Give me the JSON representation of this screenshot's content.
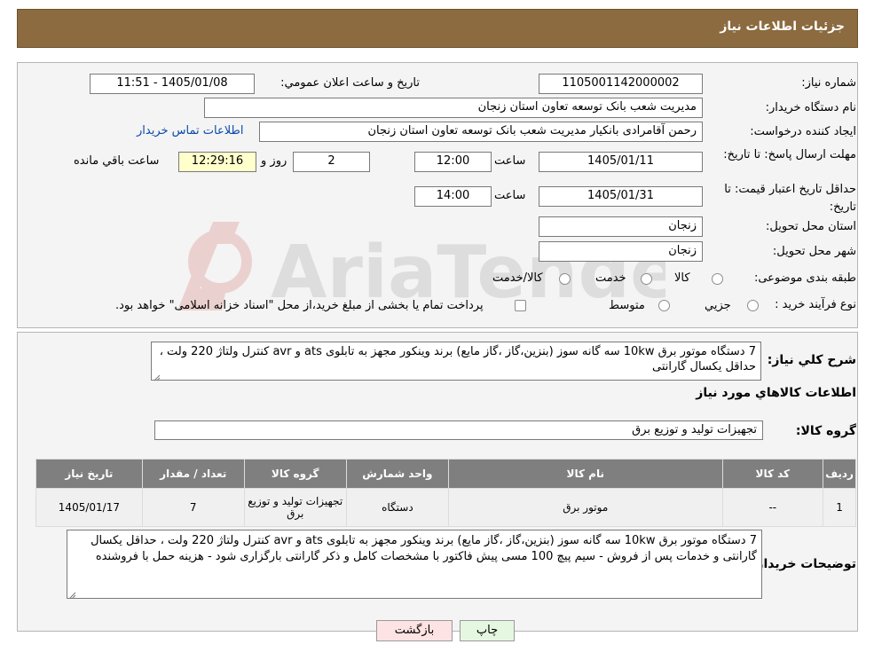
{
  "header": {
    "title": "جزئیات اطلاعات نیاز"
  },
  "form": {
    "need_number_label": "شماره نیاز:",
    "need_number": "1105001142000002",
    "announce_label": "تاریخ و ساعت اعلان عمومي:",
    "announce_value": "1405/01/08 - 11:51",
    "buyer_org_label": "نام دستگاه خریدار:",
    "buyer_org": "مدیریت شعب بانک توسعه تعاون استان زنجان",
    "creator_label": "ایجاد کننده درخواست:",
    "creator": "رحمن آقامرادی بانکیار مدیریت شعب بانک توسعه تعاون استان زنجان",
    "contact_link": "اطلاعات تماس خریدار",
    "reply_deadline_label": "مهلت ارسال پاسخ: تا تاریخ:",
    "reply_date": "1405/01/11",
    "time_label": "ساعت",
    "reply_time": "12:00",
    "days": "2",
    "days_label": "روز و",
    "remaining_time": "12:29:16",
    "remaining_label": "ساعت باقي مانده",
    "price_validity_label": "حداقل تاریخ اعتبار قیمت: تا تاریخ:",
    "validity_date": "1405/01/31",
    "validity_time": "14:00",
    "province_label": "استان محل تحویل:",
    "province": "زنجان",
    "city_label": "شهر محل تحویل:",
    "city": "زنجان",
    "category_label": "طبقه بندی موضوعی:",
    "category_options": [
      "کالا",
      "خدمت",
      "کالا/خدمت"
    ],
    "process_label": "نوع فرآیند خرید :",
    "process_options": [
      "جزیي",
      "متوسط"
    ],
    "payment_note": "پرداخت تمام یا بخشی از مبلغ خرید،از محل \"اسناد خزانه اسلامی\" خواهد بود."
  },
  "summary": {
    "description_label": "شرح کلي نیاز:",
    "description": "7 دستگاه موتور برق 10kw سه گانه سوز (بنزین،گاز ،گاز مایع) برند وینکور مجهز به تابلوی ats  و avr کنترل ولتاژ 220 ولت ، حداقل یکسال گارانتی",
    "goods_info_title": "اطلاعات کالاهاي مورد نیاز",
    "goods_group_label": "گروه کالا:",
    "goods_group": "تجهیزات تولید و توزیع برق"
  },
  "table": {
    "headers": [
      "ردیف",
      "کد کالا",
      "نام کالا",
      "واحد شمارش",
      "گروه کالا",
      "تعداد / مقدار",
      "تاریخ نیاز"
    ],
    "rows": [
      {
        "row": "1",
        "code": "--",
        "name": "موتور برق",
        "unit": "دستگاه",
        "group": "تجهیزات تولید و توزیع برق",
        "qty": "7",
        "date": "1405/01/17"
      }
    ]
  },
  "buyer_notes": {
    "label": "توضیحات خریدار:",
    "text": "7 دستگاه موتور برق 10kw سه گانه سوز (بنزین،گاز ،گاز مایع) برند وینکور مجهز به تابلوی ats  و avr کنترل ولتاژ 220 ولت ، حداقل یکسال گارانتی و خدمات پس از فروش - سیم پیچ 100 مسی پیش فاکتور با مشخصات کامل و ذکر گارانتی بارگزاری شود - هزینه حمل با فروشنده"
  },
  "buttons": {
    "print": "چاپ",
    "back": "بازگشت"
  },
  "watermark": {
    "text": "AriaTender.neT"
  },
  "colors": {
    "header": "#8b6b3f",
    "table_header": "#7f7f7f",
    "back_button": "#fde3e3",
    "print_button": "#e6f7e1"
  }
}
